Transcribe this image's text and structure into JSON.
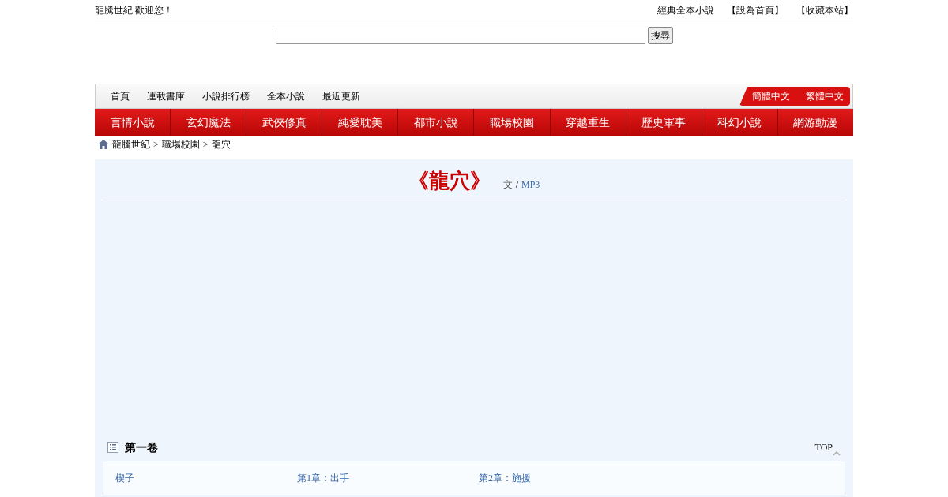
{
  "top_bar": {
    "welcome": "龍騰世紀 歡迎您！",
    "links": [
      "經典全本小說",
      "【設為首頁】",
      "【收藏本站】"
    ]
  },
  "search": {
    "button": "搜尋"
  },
  "main_nav": [
    "首頁",
    "連載書庫",
    "小說排行榜",
    "全本小說",
    "最近更新"
  ],
  "language_links": [
    "簡體中文",
    "繁體中文"
  ],
  "categories": [
    "言情小說",
    "玄幻魔法",
    "武俠修真",
    "純愛耽美",
    "都市小說",
    "職場校園",
    "穿越重生",
    "歷史軍事",
    "科幻小說",
    "網游動漫"
  ],
  "breadcrumb": [
    "龍騰世紀",
    "職場校園",
    "龍穴"
  ],
  "breadcrumb_separator": ">",
  "book": {
    "title": "《龍穴》",
    "text_label": "文",
    "separator": "/",
    "mp3_link": "MP3"
  },
  "volume": {
    "title": "第一卷",
    "top_link": "TOP",
    "chapters": [
      "楔子",
      "第1章：出手",
      "第2章：施援"
    ]
  }
}
